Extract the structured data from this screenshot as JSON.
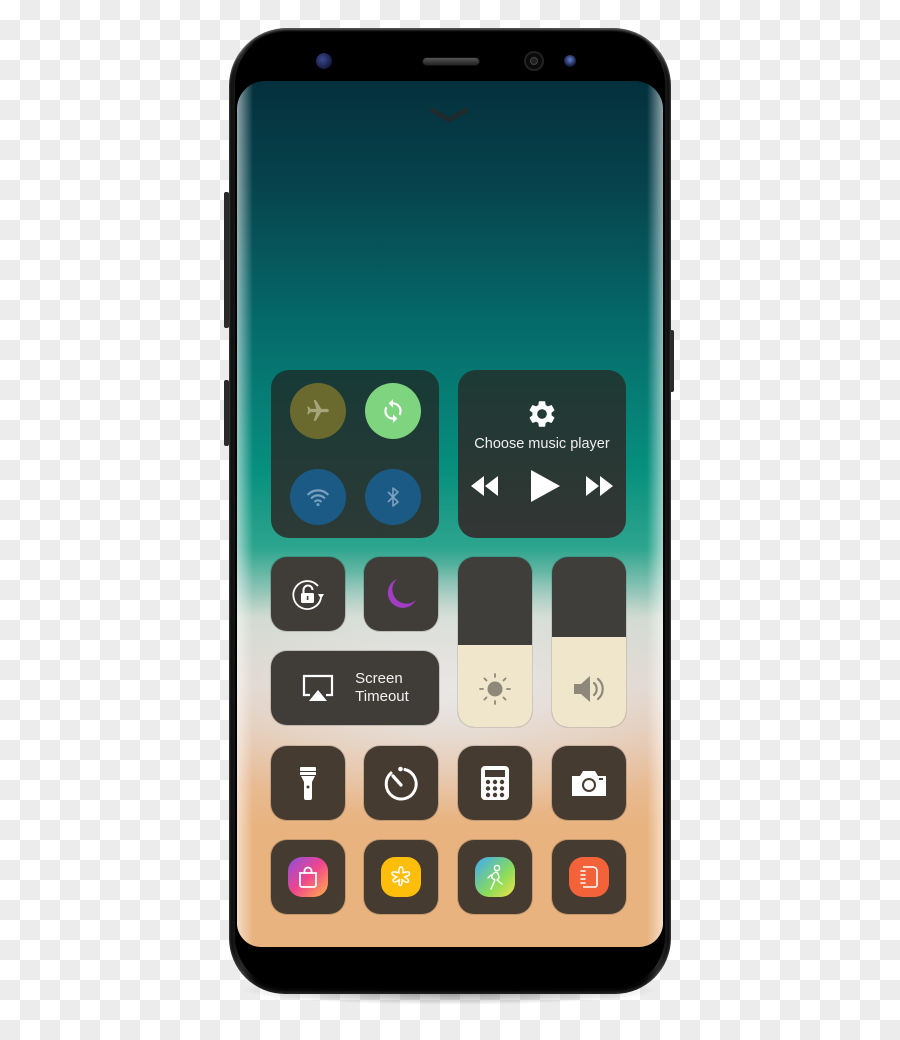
{
  "device": {
    "model_hint": "smartphone",
    "bezel_color": "#000000"
  },
  "screen": {
    "collapse_icon": "chevron-down-icon",
    "gradient_colors": [
      "#04303d",
      "#07907e",
      "#e0d3c9",
      "#e8b37f"
    ]
  },
  "connectivity": {
    "airplane": {
      "icon": "airplane-icon",
      "active": false,
      "color": "#6b6a2e"
    },
    "sync": {
      "icon": "sync-icon",
      "active": true,
      "color": "#7fd47f"
    },
    "wifi": {
      "icon": "wifi-icon",
      "active": false,
      "color": "#1c5a86"
    },
    "bluetooth": {
      "icon": "bluetooth-icon",
      "active": false,
      "color": "#1c5a86"
    }
  },
  "music": {
    "settings_icon": "gear-icon",
    "title": "Choose music player",
    "controls": [
      "rewind-icon",
      "play-icon",
      "fast-forward-icon"
    ]
  },
  "toggles": {
    "rotation_lock": {
      "icon": "rotation-lock-icon"
    },
    "do_not_disturb": {
      "icon": "moon-icon",
      "color": "#a23cc4"
    },
    "screen_timeout": {
      "icon": "screen-cast-icon",
      "label_line1": "Screen",
      "label_line2": "Timeout"
    }
  },
  "sliders": {
    "brightness": {
      "icon": "sun-icon",
      "level_percent": 48
    },
    "volume": {
      "icon": "speaker-icon",
      "level_percent": 53
    }
  },
  "shortcuts": [
    {
      "name": "flashlight",
      "icon": "flashlight-icon"
    },
    {
      "name": "timer",
      "icon": "timer-icon"
    },
    {
      "name": "calculator",
      "icon": "calculator-icon"
    },
    {
      "name": "camera",
      "icon": "camera-icon"
    }
  ],
  "apps": [
    {
      "name": "galaxy-store",
      "icon": "shopping-bag-icon",
      "colors": [
        "#8a4fe0",
        "#f0468c",
        "#ffb347"
      ]
    },
    {
      "name": "bixby-home",
      "icon": "flower-icon",
      "colors": [
        "#ffc107",
        "#ffb300"
      ]
    },
    {
      "name": "samsung-health",
      "icon": "running-person-icon",
      "colors": [
        "#3fa9f5",
        "#8bdc5a",
        "#f2e24a"
      ]
    },
    {
      "name": "notes",
      "icon": "notebook-icon",
      "colors": [
        "#f4623a",
        "#f4623a"
      ]
    }
  ]
}
